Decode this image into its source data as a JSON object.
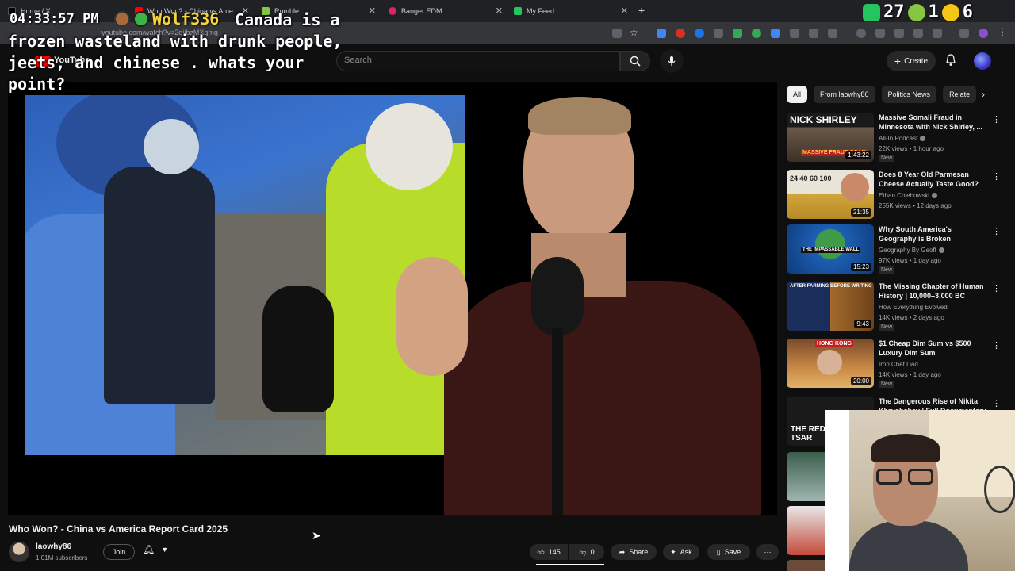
{
  "browser": {
    "tabs": [
      {
        "title": "Home / X",
        "favicon_color": "#000000"
      },
      {
        "title": "Who Won? - China vs Ame",
        "favicon_color": "#ff0000"
      },
      {
        "title": "Rumble",
        "favicon_color": "#85c742"
      },
      {
        "title": "Banger EDM",
        "favicon_color": "#e0245e"
      },
      {
        "title": "My Feed",
        "favicon_color": "#22c55e"
      }
    ],
    "new_tab_label": "+",
    "url": "youtube.com/watch?v=2qiibzMXgmg"
  },
  "overlay": {
    "clock": "04:33:57 PM",
    "chat_username": "Wolf336",
    "chat_message": "Canada is a frozen wasteland with drunk people, jeets, and chinese . whats your point?",
    "stats": {
      "a": "27",
      "b": "1",
      "c": "6"
    }
  },
  "youtube": {
    "logo_text": "YouTube",
    "search_placeholder": "Search",
    "create_label": "Create",
    "accent_color": "#ff0000"
  },
  "video": {
    "title": "Who Won? - China vs America Report Card 2025",
    "channel": {
      "name": "laowhy86",
      "subscribers": "1.01M subscribers"
    },
    "join_label": "Join",
    "likes": "145",
    "dislikes": "0",
    "share_label": "Share",
    "ask_label": "Ask",
    "save_label": "Save",
    "more_label": "⋯"
  },
  "sidebar": {
    "chips": [
      "All",
      "From laowhy86",
      "Politics News",
      "Relate"
    ],
    "active_chip": "All",
    "recommendations": [
      {
        "title": "Massive Somali Fraud in Minnesota with Nick Shirley, ...",
        "channel": "All-In Podcast",
        "stats": "22K views • 1 hour ago",
        "badge": "New",
        "duration": "1:43:22",
        "thumb_text": "NICK SHIRLEY",
        "thumb_sub": "MASSIVE FRAUD SCAN"
      },
      {
        "title": "Does 8 Year Old Parmesan Cheese Actually Taste Good?",
        "channel": "Ethan Chlebowski",
        "stats": "255K views • 12 days ago",
        "badge": "",
        "duration": "21:35",
        "thumb_text": "24  40  60  100",
        "thumb_sub": ""
      },
      {
        "title": "Why South America's Geography is Broken",
        "channel": "Geography By Geoff",
        "stats": "97K views • 1 day ago",
        "badge": "New",
        "duration": "15:23",
        "thumb_text": "THE IMPASSABLE WALL",
        "thumb_sub": ""
      },
      {
        "title": "The Missing Chapter of Human History | 10,000–3,000 BC",
        "channel": "How Everything Evolved",
        "stats": "14K views • 2 days ago",
        "badge": "New",
        "duration": "9:43",
        "thumb_text": "AFTER FARMING   BEFORE WRITING",
        "thumb_sub": ""
      },
      {
        "title": "$1 Cheap Dim Sum vs $500 Luxury Dim Sum",
        "channel": "Iron Chef Dad",
        "stats": "14K views • 1 day ago",
        "badge": "New",
        "duration": "20:00",
        "thumb_text": "HONG KONG",
        "thumb_sub": ""
      },
      {
        "title": "The Dangerous Rise of Nikita Khrushchev | Full Documentary",
        "channel": "",
        "stats": "",
        "badge": "",
        "duration": "",
        "thumb_text": "THE RED TSAR",
        "thumb_sub": ""
      }
    ]
  }
}
